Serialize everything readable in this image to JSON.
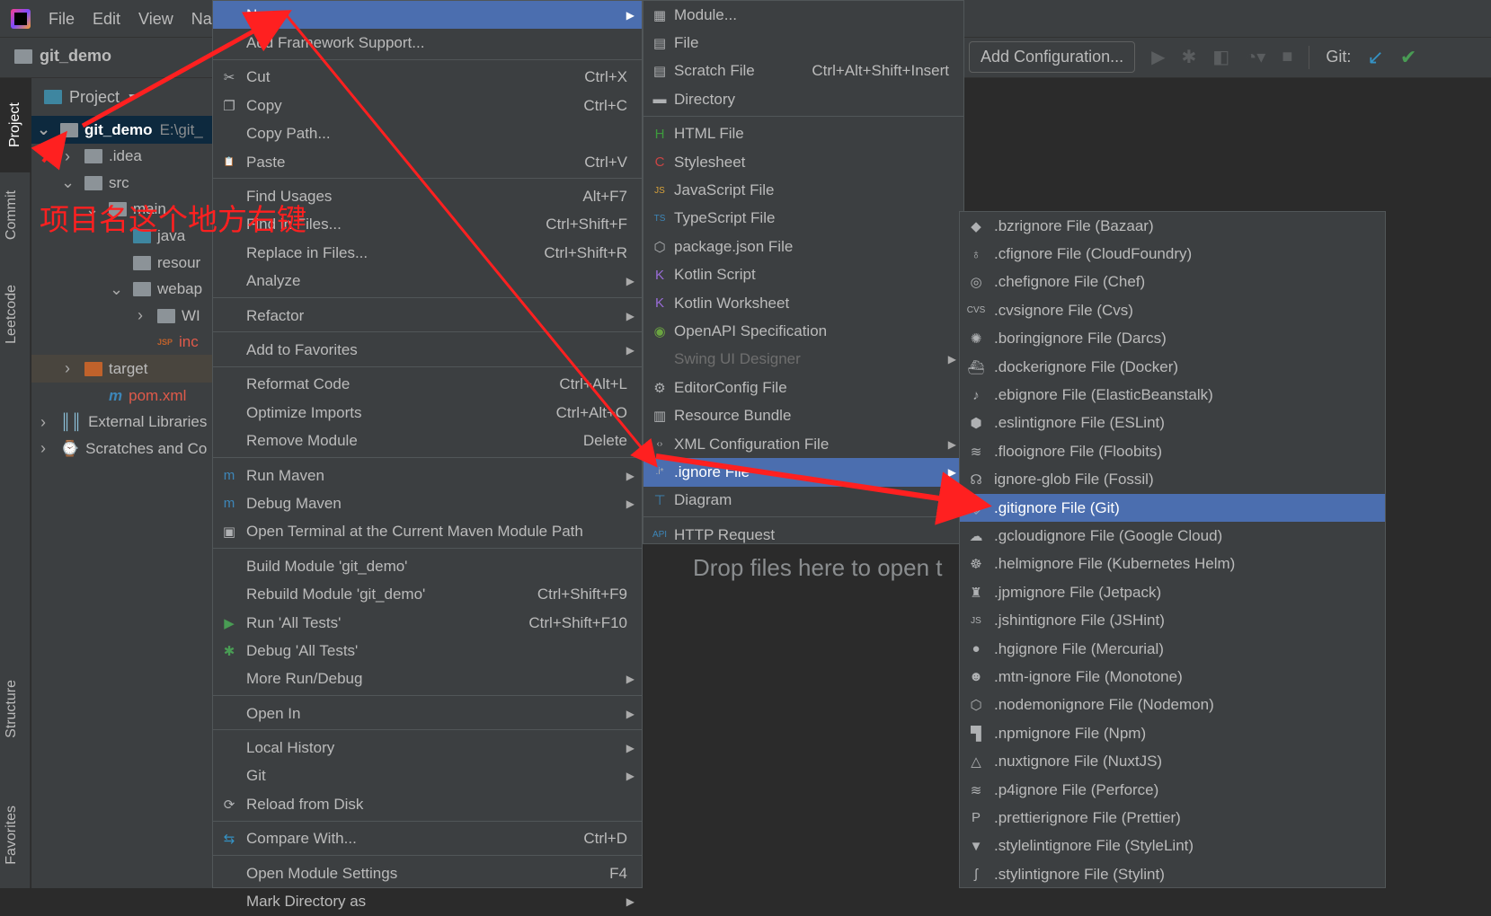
{
  "menubar": {
    "items": [
      "File",
      "Edit",
      "View",
      "Nav"
    ]
  },
  "breadcrumb": {
    "project": "git_demo"
  },
  "toolbar": {
    "add_config": "Add Configuration...",
    "git_label": "Git:"
  },
  "tool_windows": [
    "Project",
    "Commit",
    "Leetcode",
    "Structure",
    "Favorites"
  ],
  "project_panel": {
    "title": "Project",
    "tree": [
      {
        "label": "git_demo",
        "extra": "E:\\git_",
        "indent": 0,
        "chev": "v",
        "icon": "module-folder-icon",
        "state": "selected"
      },
      {
        "label": ".idea",
        "indent": 1,
        "chev": ">",
        "icon": "folder-icon"
      },
      {
        "label": "src",
        "indent": 1,
        "chev": "v",
        "icon": "folder-icon"
      },
      {
        "label": "main",
        "indent": 2,
        "chev": "v",
        "icon": "folder-icon"
      },
      {
        "label": "java",
        "indent": 3,
        "chev": "",
        "icon": "source-folder-icon"
      },
      {
        "label": "resour",
        "indent": 3,
        "chev": "",
        "icon": "resource-folder-icon"
      },
      {
        "label": "webap",
        "indent": 3,
        "chev": "v",
        "icon": "web-folder-icon"
      },
      {
        "label": "WI",
        "indent": 4,
        "chev": ">",
        "icon": "folder-icon"
      },
      {
        "label": "inc",
        "indent": 4,
        "chev": "",
        "icon": "jsp-file-icon",
        "color": "#e05a4a"
      },
      {
        "label": "target",
        "indent": 1,
        "chev": ">",
        "icon": "excluded-folder-icon",
        "state": "target"
      },
      {
        "label": "pom.xml",
        "indent": 2,
        "chev": "",
        "icon": "maven-icon",
        "color": "#e05a4a"
      },
      {
        "label": "External Libraries",
        "indent": 0,
        "chev": ">",
        "icon": "libraries-icon"
      },
      {
        "label": "Scratches and Co",
        "indent": 0,
        "chev": ">",
        "icon": "scratches-icon"
      }
    ]
  },
  "context_menu": [
    {
      "label": "New",
      "arrow": true,
      "state": "highlighted"
    },
    {
      "label": "Add Framework Support..."
    },
    {
      "sep": true
    },
    {
      "label": "Cut",
      "shortcut": "Ctrl+X",
      "icon": "scissors-icon"
    },
    {
      "label": "Copy",
      "shortcut": "Ctrl+C",
      "icon": "copy-icon"
    },
    {
      "label": "Copy Path..."
    },
    {
      "label": "Paste",
      "shortcut": "Ctrl+V",
      "icon": "clipboard-icon"
    },
    {
      "sep": true
    },
    {
      "label": "Find Usages",
      "shortcut": "Alt+F7"
    },
    {
      "label": "Find in Files...",
      "shortcut": "Ctrl+Shift+F"
    },
    {
      "label": "Replace in Files...",
      "shortcut": "Ctrl+Shift+R"
    },
    {
      "label": "Analyze",
      "arrow": true
    },
    {
      "sep": true
    },
    {
      "label": "Refactor",
      "arrow": true
    },
    {
      "sep": true
    },
    {
      "label": "Add to Favorites",
      "arrow": true
    },
    {
      "sep": true
    },
    {
      "label": "Reformat Code",
      "shortcut": "Ctrl+Alt+L"
    },
    {
      "label": "Optimize Imports",
      "shortcut": "Ctrl+Alt+O"
    },
    {
      "label": "Remove Module",
      "shortcut": "Delete"
    },
    {
      "sep": true
    },
    {
      "label": "Run Maven",
      "arrow": true,
      "icon": "maven-run-icon"
    },
    {
      "label": "Debug Maven",
      "arrow": true,
      "icon": "maven-debug-icon"
    },
    {
      "label": "Open Terminal at the Current Maven Module Path",
      "icon": "maven-terminal-icon"
    },
    {
      "sep": true
    },
    {
      "label": "Build Module 'git_demo'"
    },
    {
      "label": "Rebuild Module 'git_demo'",
      "shortcut": "Ctrl+Shift+F9"
    },
    {
      "label": "Run 'All Tests'",
      "shortcut": "Ctrl+Shift+F10",
      "icon": "run-icon"
    },
    {
      "label": "Debug 'All Tests'",
      "icon": "debug-icon"
    },
    {
      "label": "More Run/Debug",
      "arrow": true
    },
    {
      "sep": true
    },
    {
      "label": "Open In",
      "arrow": true
    },
    {
      "sep": true
    },
    {
      "label": "Local History",
      "arrow": true
    },
    {
      "label": "Git",
      "arrow": true
    },
    {
      "label": "Reload from Disk",
      "icon": "reload-icon"
    },
    {
      "sep": true
    },
    {
      "label": "Compare With...",
      "shortcut": "Ctrl+D",
      "icon": "compare-icon"
    },
    {
      "sep": true
    },
    {
      "label": "Open Module Settings",
      "shortcut": "F4"
    },
    {
      "label": "Mark Directory as",
      "arrow": true
    }
  ],
  "new_menu": [
    {
      "label": "Module...",
      "icon": "module-icon"
    },
    {
      "label": "File",
      "icon": "file-icon"
    },
    {
      "label": "Scratch File",
      "shortcut": "Ctrl+Alt+Shift+Insert",
      "icon": "scratch-icon"
    },
    {
      "label": "Directory",
      "icon": "folder-icon"
    },
    {
      "sep": true
    },
    {
      "label": "HTML File",
      "icon": "html-icon"
    },
    {
      "label": "Stylesheet",
      "icon": "css-icon"
    },
    {
      "label": "JavaScript File",
      "icon": "js-icon"
    },
    {
      "label": "TypeScript File",
      "icon": "ts-icon"
    },
    {
      "label": "package.json File",
      "icon": "nodejs-icon"
    },
    {
      "label": "Kotlin Script",
      "icon": "kotlin-icon"
    },
    {
      "label": "Kotlin Worksheet",
      "icon": "kotlin-icon"
    },
    {
      "label": "OpenAPI Specification",
      "icon": "openapi-icon"
    },
    {
      "label": "Swing UI Designer",
      "arrow": true,
      "state": "disabled"
    },
    {
      "label": "EditorConfig File",
      "icon": "gear-icon"
    },
    {
      "label": "Resource Bundle",
      "icon": "resource-bundle-icon"
    },
    {
      "label": "XML Configuration File",
      "arrow": true,
      "icon": "xml-icon"
    },
    {
      "label": ".ignore File",
      "arrow": true,
      "icon": "ignore-icon",
      "state": "highlighted"
    },
    {
      "label": "Diagram",
      "icon": "diagram-icon"
    },
    {
      "sep": true
    },
    {
      "label": "HTTP Request",
      "icon": "api-icon"
    }
  ],
  "ignore_menu": [
    {
      "label": ".bzrignore File (Bazaar)",
      "icon": "bazaar-icon"
    },
    {
      "label": ".cfignore File (CloudFoundry)",
      "icon": "cloudfoundry-icon"
    },
    {
      "label": ".chefignore File (Chef)",
      "icon": "chef-icon"
    },
    {
      "label": ".cvsignore File (Cvs)",
      "icon": "cvs-icon"
    },
    {
      "label": ".boringignore File (Darcs)",
      "icon": "darcs-icon"
    },
    {
      "label": ".dockerignore File (Docker)",
      "icon": "docker-icon"
    },
    {
      "label": ".ebignore File (ElasticBeanstalk)",
      "icon": "elasticbeanstalk-icon"
    },
    {
      "label": ".eslintignore File (ESLint)",
      "icon": "eslint-icon"
    },
    {
      "label": ".flooignore File (Floobits)",
      "icon": "floobits-icon"
    },
    {
      "label": "ignore-glob File (Fossil)",
      "icon": "fossil-icon"
    },
    {
      "label": ".gitignore File (Git)",
      "icon": "git-icon",
      "state": "highlighted"
    },
    {
      "label": ".gcloudignore File (Google Cloud)",
      "icon": "google-cloud-icon"
    },
    {
      "label": ".helmignore File (Kubernetes Helm)",
      "icon": "helm-icon"
    },
    {
      "label": ".jpmignore File (Jetpack)",
      "icon": "jetpack-icon"
    },
    {
      "label": ".jshintignore File (JSHint)",
      "icon": "jshint-icon"
    },
    {
      "label": ".hgignore File (Mercurial)",
      "icon": "mercurial-icon"
    },
    {
      "label": ".mtn-ignore File (Monotone)",
      "icon": "monotone-icon"
    },
    {
      "label": ".nodemonignore File (Nodemon)",
      "icon": "nodemon-icon"
    },
    {
      "label": ".npmignore File (Npm)",
      "icon": "npm-icon"
    },
    {
      "label": ".nuxtignore File (NuxtJS)",
      "icon": "nuxt-icon"
    },
    {
      "label": ".p4ignore File (Perforce)",
      "icon": "perforce-icon"
    },
    {
      "label": ".prettierignore File (Prettier)",
      "icon": "prettier-icon"
    },
    {
      "label": ".stylelintignore File (StyleLint)",
      "icon": "stylelint-icon"
    },
    {
      "label": ".stylintignore File (Stylint)",
      "icon": "stylint-icon"
    }
  ],
  "editor": {
    "drop_hint": "Drop files here to open t"
  },
  "annotation": {
    "text": "项目名这个地方右键",
    "color": "#ff2020"
  },
  "colors": {
    "menu_bg": "#3c3f41",
    "highlight": "#4b6eaf",
    "text": "#bbbbbb",
    "annotation_arrow": "#ff2020"
  }
}
